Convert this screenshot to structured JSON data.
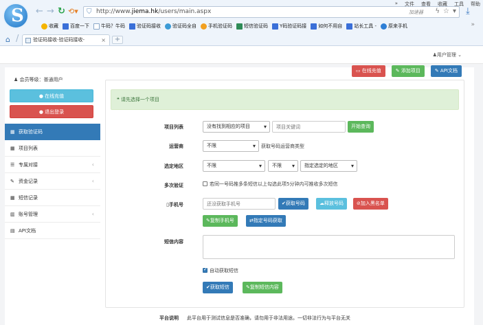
{
  "browser": {
    "menu": [
      "»",
      "文件",
      "查看",
      "收藏",
      "工具",
      "帮助"
    ],
    "url_prefix": "http://www.",
    "url_domain": "jiema.hk",
    "url_path": "/users/main.aspx",
    "accelerate": "加速器",
    "bookmarks": [
      {
        "label": "收藏",
        "color": "#f5b400"
      },
      {
        "label": "百度一下",
        "color": "#3a6fd8"
      },
      {
        "label": "牛码？牛码",
        "color": "#8aa7c7"
      },
      {
        "label": "验证码接收",
        "color": "#3a6fd8"
      },
      {
        "label": "验证码全自",
        "color": "#3c9bd6"
      },
      {
        "label": "手机验证码",
        "color": "#f2a020"
      },
      {
        "label": "短信验证码",
        "color": "#2e8b57"
      },
      {
        "label": "Y码验证码接",
        "color": "#3a6fd8"
      },
      {
        "label": "如何不用自",
        "color": "#3a6fd8"
      },
      {
        "label": "站长工具 -",
        "color": "#3a6fd8"
      },
      {
        "label": "原来手机",
        "color": "#2e7fd6"
      }
    ],
    "tab_label": "验证码接收-验证码接收-",
    "tab_close": "×",
    "tab_new": "+"
  },
  "header": {
    "user_menu": "用户管理"
  },
  "sidebar": {
    "member_level": "会员等级：普通用户",
    "recharge_button": "在线充值",
    "logout_button": "退出登录",
    "items": [
      {
        "label": "获取验证码",
        "icon": "grid-icon",
        "glyph": "▦",
        "arrow": ""
      },
      {
        "label": "项目列表",
        "icon": "grid-icon",
        "glyph": "▦",
        "arrow": ""
      },
      {
        "label": "专属对接",
        "icon": "list-icon",
        "glyph": "☰",
        "arrow": "‹"
      },
      {
        "label": "资金记录",
        "icon": "pencil-icon",
        "glyph": "✎",
        "arrow": "‹"
      },
      {
        "label": "短信记录",
        "icon": "grid-icon",
        "glyph": "▦",
        "arrow": ""
      },
      {
        "label": "账号管理",
        "icon": "chart-icon",
        "glyph": "▥",
        "arrow": "‹"
      },
      {
        "label": "API文档",
        "icon": "window-icon",
        "glyph": "▤",
        "arrow": ""
      }
    ]
  },
  "toolbar": {
    "recharge": "在线充值",
    "add_project": "添加项目",
    "api_doc": "API文档"
  },
  "alert": {
    "text": "❝ 请先选择一个项目"
  },
  "form": {
    "project_label": "项目列表",
    "project_value": "没有找到相应的项目",
    "keyword_placeholder": "项目关键词",
    "search_button": "开始查询",
    "carrier_label": "运营商",
    "carrier_value": "不限",
    "carrier_note": "获取号码运营商类型",
    "region_label": "选定地区",
    "province_value": "不限",
    "city_value": "不限",
    "region_select_value": "指定选定的地区",
    "multi_label": "多次验证",
    "multi_note": "若同一号码推多条短信以上勾选此项5分钟内可推收多次短信",
    "phone_label": "手机号",
    "phone_placeholder": "还没获取手机号",
    "get_number": "获取号码",
    "release_number": "释放号码",
    "blacklist": "加入黑名单",
    "copy_phone": "复制手机号",
    "assign_number": "指定号码获取",
    "sms_label": "短信内容",
    "auto_sms": "自动获取短信",
    "get_sms": "获取短信",
    "copy_sms": "复制短信内容"
  },
  "platform": {
    "label": "平台说明",
    "text": "此平台用于测试信息是否准确，请勿用于非法用途。一切非法行为与平台无关"
  }
}
